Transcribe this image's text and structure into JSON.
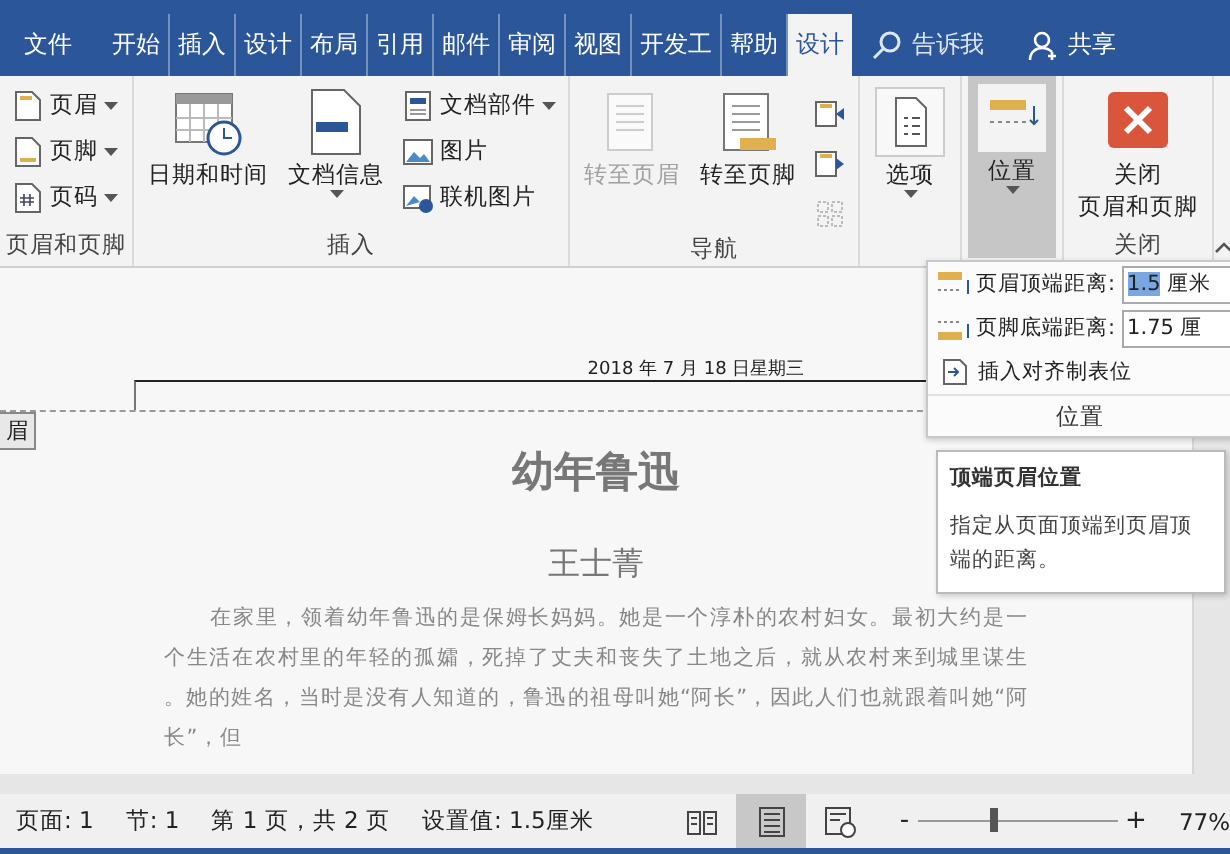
{
  "tabs": [
    {
      "label": "文件",
      "selected": false
    },
    {
      "label": "开始",
      "selected": false
    },
    {
      "label": "插入",
      "selected": false
    },
    {
      "label": "设计",
      "selected": false
    },
    {
      "label": "布局",
      "selected": false
    },
    {
      "label": "引用",
      "selected": false
    },
    {
      "label": "邮件",
      "selected": false
    },
    {
      "label": "审阅",
      "selected": false
    },
    {
      "label": "视图",
      "selected": false
    },
    {
      "label": "开发工",
      "selected": false
    },
    {
      "label": "帮助",
      "selected": false
    },
    {
      "label": "设计",
      "selected": true
    }
  ],
  "tell_me": "告诉我",
  "share": "共享",
  "ribbon": {
    "groups": [
      {
        "label": "页眉和页脚",
        "columns": [
          {
            "kind": "stack",
            "items": [
              {
                "label": "页眉",
                "dropdown": true
              },
              {
                "label": "页脚",
                "dropdown": true
              },
              {
                "label": "页码",
                "dropdown": true
              }
            ]
          }
        ]
      },
      {
        "label": "插入",
        "columns": [
          {
            "kind": "large",
            "lines": [
              "日期和时间"
            ],
            "dropdown": false,
            "disabled": false,
            "pressed": false
          },
          {
            "kind": "large",
            "lines": [
              "文档信息"
            ],
            "dropdown": true,
            "disabled": false,
            "pressed": false
          },
          {
            "kind": "stack",
            "items": [
              {
                "label": "文档部件",
                "dropdown": true
              },
              {
                "label": "图片",
                "dropdown": false
              },
              {
                "label": "联机图片",
                "dropdown": false
              }
            ]
          }
        ]
      },
      {
        "label": "导航",
        "columns": [
          {
            "kind": "large",
            "lines": [
              "转至页眉"
            ],
            "dropdown": false,
            "disabled": true,
            "pressed": false
          },
          {
            "kind": "large",
            "lines": [
              "转至页脚"
            ],
            "dropdown": false,
            "disabled": false,
            "pressed": false
          },
          {
            "kind": "icons"
          }
        ]
      },
      {
        "columns": [
          {
            "kind": "large",
            "lines": [
              "选项"
            ],
            "dropdown": true,
            "disabled": false,
            "pressed": false
          }
        ]
      },
      {
        "columns": [
          {
            "kind": "large",
            "lines": [
              "位置"
            ],
            "dropdown": true,
            "disabled": false,
            "pressed": true
          }
        ]
      },
      {
        "label": "关闭",
        "columns": [
          {
            "kind": "large",
            "lines": [
              "关闭",
              "页眉和页脚"
            ],
            "dropdown": false,
            "disabled": false,
            "pressed": false
          }
        ]
      }
    ]
  },
  "position_menu": {
    "rows": [
      {
        "kind": "field",
        "label": "页眉顶端距离:",
        "value": "1.5",
        "unit": "厘米",
        "selected": true
      },
      {
        "kind": "field",
        "label": "页脚底端距离:",
        "value": "1.75",
        "unit": "厘",
        "selected": false
      },
      {
        "kind": "action",
        "label": "插入对齐制表位"
      }
    ],
    "footer": "位置"
  },
  "tooltip": {
    "title": "顶端页眉位置",
    "text": "指定从页面顶端到页眉顶端的距离。"
  },
  "document": {
    "header_date": "2018 年 7 月 18 日星期三",
    "header_tag": "眉",
    "title": "幼年鲁迅",
    "author": "王士菁",
    "paragraph": "在家里，领着幼年鲁迅的是保姆长妈妈。她是一个淳朴的农村妇女。最初大约是一个生活在农村里的年轻的孤孀，死掉了丈夫和丧失了土地之后，就从农村来到城里谋生。她的姓名，当时是没有人知道的，鲁迅的祖母叫她“阿长”，因此人们也就跟着叫她“阿长”，但"
  },
  "status_bar": {
    "items": [
      "页面: 1",
      "节: 1",
      "第 1 页，共 2 页",
      "设置值: 1.5厘米"
    ],
    "views": [
      {
        "selected": false
      },
      {
        "selected": true
      },
      {
        "selected": false
      }
    ],
    "zoom_minus": "-",
    "zoom_plus": "+",
    "zoom": {
      "level": 0.38
    },
    "zoom_percent": "77%"
  }
}
